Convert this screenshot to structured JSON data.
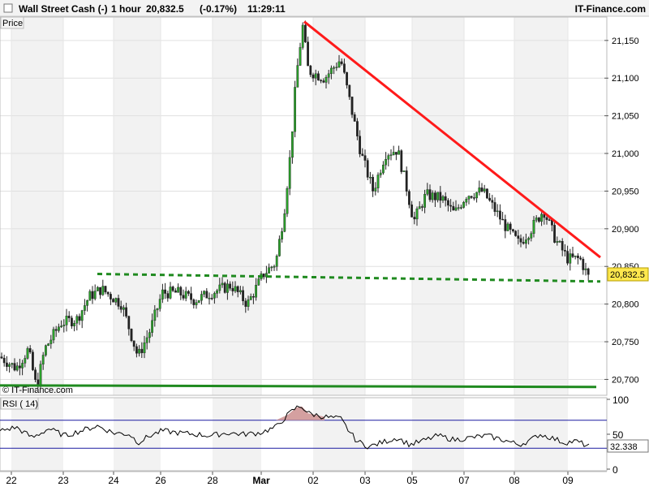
{
  "header": {
    "title": "Wall Street Cash (-)",
    "interval": "1 hour",
    "price": "20,832.5",
    "change": "(-0.17%)",
    "time": "11:29:11",
    "source": "IT-Finance.com"
  },
  "price_panel": {
    "label": "Price",
    "watermark": "© IT-Finance.com"
  },
  "rsi_panel": {
    "label": "RSI ( 14)"
  },
  "colors": {
    "bull_candle": "#2aa02a",
    "bear_candle": "#222222",
    "resistance": "#ff1a1a",
    "dotted_support": "#1f8a1f",
    "solid_support": "#1f8a1f",
    "rsi_line": "#000000",
    "rsi_band": "#1a1aa0",
    "rsi_overbought_fill": "#d4a0a0",
    "last_price_box": "#ffe84d"
  },
  "chart_data": [
    {
      "type": "candlestick",
      "title": "Wall Street Cash (-)",
      "ylim": [
        20680,
        21180
      ],
      "ytick_labels": [
        "21,150",
        "21,100",
        "21,050",
        "21,000",
        "20,950",
        "20,900",
        "20,850",
        "20,800",
        "20,750",
        "20,700"
      ],
      "ytick_values": [
        21150,
        21100,
        21050,
        21000,
        20950,
        20900,
        20850,
        20800,
        20750,
        20700
      ],
      "xtick_labels": [
        "22",
        "23",
        "24",
        "26",
        "28",
        "Mar",
        "02",
        "03",
        "05",
        "07",
        "08",
        "09"
      ],
      "last_price": 20832.5,
      "last_price_label": "20,832.5",
      "grid": true,
      "price_path": [
        [
          0,
          20730
        ],
        [
          20,
          20715
        ],
        [
          35,
          20740
        ],
        [
          45,
          20688
        ],
        [
          55,
          20740
        ],
        [
          75,
          20775
        ],
        [
          95,
          20780
        ],
        [
          110,
          20810
        ],
        [
          125,
          20820
        ],
        [
          150,
          20800
        ],
        [
          170,
          20730
        ],
        [
          185,
          20765
        ],
        [
          200,
          20815
        ],
        [
          220,
          20815
        ],
        [
          240,
          20805
        ],
        [
          260,
          20815
        ],
        [
          285,
          20825
        ],
        [
          305,
          20800
        ],
        [
          325,
          20840
        ],
        [
          340,
          20855
        ],
        [
          350,
          20920
        ],
        [
          358,
          21000
        ],
        [
          365,
          21100
        ],
        [
          373,
          21170
        ],
        [
          380,
          21110
        ],
        [
          400,
          21100
        ],
        [
          420,
          21125
        ],
        [
          435,
          21050
        ],
        [
          445,
          21000
        ],
        [
          460,
          20950
        ],
        [
          475,
          21000
        ],
        [
          490,
          21005
        ],
        [
          500,
          20960
        ],
        [
          510,
          20910
        ],
        [
          525,
          20945
        ],
        [
          545,
          20940
        ],
        [
          560,
          20920
        ],
        [
          575,
          20945
        ],
        [
          595,
          20950
        ],
        [
          610,
          20925
        ],
        [
          625,
          20900
        ],
        [
          640,
          20880
        ],
        [
          655,
          20900
        ],
        [
          670,
          20925
        ],
        [
          685,
          20885
        ],
        [
          700,
          20860
        ],
        [
          715,
          20860
        ],
        [
          727,
          20832
        ]
      ],
      "lines": [
        {
          "name": "",
          "kind": "resistance",
          "from": [
            375,
            21175
          ],
          "to": [
            740,
            20862
          ]
        },
        {
          "name": "",
          "kind": "dotted_support",
          "from": [
            120,
            20840
          ],
          "to": [
            740,
            20830
          ]
        },
        {
          "name": "",
          "kind": "solid_support",
          "from": [
            0,
            20692
          ],
          "to": [
            735,
            20690
          ]
        }
      ]
    },
    {
      "type": "line",
      "title": "RSI ( 14)",
      "ylim": [
        0,
        100
      ],
      "ytick_labels": [
        "100",
        "50",
        "0"
      ],
      "ytick_values": [
        100,
        50,
        0
      ],
      "bands": [
        70,
        30
      ],
      "last_value": 32.338,
      "last_value_label": "32.338",
      "rsi_path": [
        [
          0,
          55
        ],
        [
          20,
          60
        ],
        [
          40,
          45
        ],
        [
          60,
          58
        ],
        [
          80,
          48
        ],
        [
          100,
          55
        ],
        [
          120,
          62
        ],
        [
          140,
          52
        ],
        [
          160,
          50
        ],
        [
          170,
          38
        ],
        [
          185,
          48
        ],
        [
          200,
          55
        ],
        [
          220,
          52
        ],
        [
          240,
          50
        ],
        [
          260,
          48
        ],
        [
          280,
          52
        ],
        [
          300,
          50
        ],
        [
          320,
          52
        ],
        [
          340,
          60
        ],
        [
          355,
          78
        ],
        [
          365,
          88
        ],
        [
          372,
          90
        ],
        [
          380,
          80
        ],
        [
          400,
          75
        ],
        [
          420,
          72
        ],
        [
          430,
          55
        ],
        [
          440,
          40
        ],
        [
          455,
          32
        ],
        [
          470,
          38
        ],
        [
          490,
          45
        ],
        [
          505,
          35
        ],
        [
          520,
          40
        ],
        [
          540,
          48
        ],
        [
          560,
          42
        ],
        [
          580,
          45
        ],
        [
          600,
          48
        ],
        [
          620,
          42
        ],
        [
          640,
          35
        ],
        [
          655,
          42
        ],
        [
          665,
          50
        ],
        [
          680,
          45
        ],
        [
          695,
          38
        ],
        [
          710,
          40
        ],
        [
          727,
          32.3
        ]
      ]
    }
  ]
}
